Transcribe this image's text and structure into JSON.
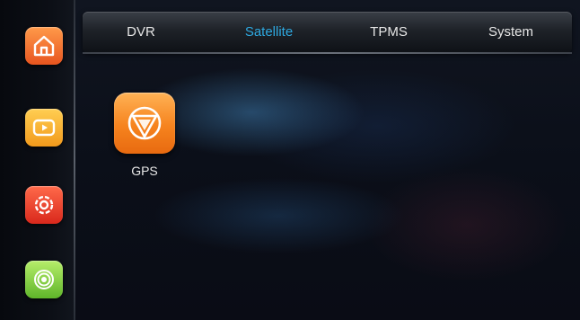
{
  "tabs": [
    {
      "label": "DVR",
      "active": false
    },
    {
      "label": "Satellite",
      "active": true
    },
    {
      "label": "TPMS",
      "active": false
    },
    {
      "label": "System",
      "active": false
    }
  ],
  "sidebar": {
    "buttons": [
      {
        "icon": "home-icon",
        "color": "#f07030"
      },
      {
        "icon": "video-icon",
        "color": "#f4b030"
      },
      {
        "icon": "gear-icon",
        "color": "#e83a25"
      },
      {
        "icon": "signal-icon",
        "color": "#8ad045"
      }
    ]
  },
  "apps": [
    {
      "label": "GPS",
      "icon": "gps-icon",
      "color": "#f6831e"
    }
  ],
  "colors": {
    "active_tab": "#2ea8e0",
    "tab_text": "#e6e6e6"
  }
}
